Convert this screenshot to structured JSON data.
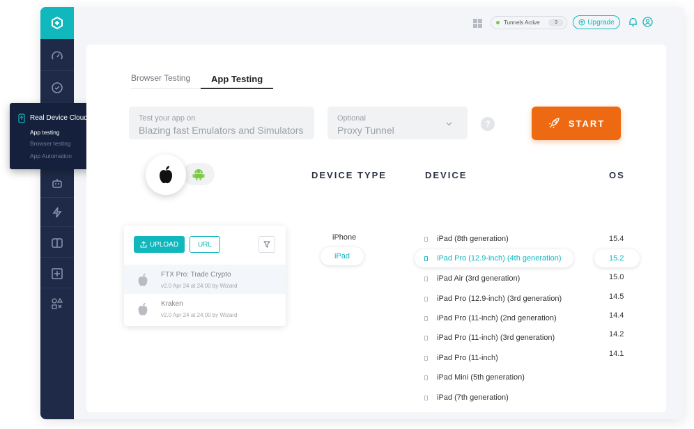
{
  "topbar": {
    "tunnels_label": "Tunnels Active",
    "tunnels_count": "3",
    "upgrade_label": "Upgrade"
  },
  "sidebar": {
    "flyout": {
      "title": "Real Device Cloud",
      "items": [
        {
          "label": "App testing",
          "active": true
        },
        {
          "label": "Browser testing",
          "active": false
        },
        {
          "label": "App Automation",
          "active": false
        }
      ]
    }
  },
  "tabs": {
    "browser": "Browser Testing",
    "app": "App Testing"
  },
  "form": {
    "target_label": "Test your app on",
    "target_value": "Blazing fast Emulators and Simulators",
    "tunnel_label": "Optional",
    "tunnel_value": "Proxy Tunnel",
    "help": "?",
    "start_label": "START"
  },
  "columns": {
    "device_type": "DEVICE TYPE",
    "device": "DEVICE",
    "os": "OS"
  },
  "apps": {
    "upload_label": "UPLOAD",
    "url_label": "URL",
    "items": [
      {
        "name": "FTX Pro: Trade Crypto",
        "meta": "v2.0 Apr 24 at 24:00 by Wizard",
        "selected": true
      },
      {
        "name": "Kraken",
        "meta": "v2.0 Apr 24 at 24:00 by Wizard",
        "selected": false
      }
    ]
  },
  "device_types": [
    {
      "label": "iPhone",
      "selected": false
    },
    {
      "label": "iPad",
      "selected": true
    }
  ],
  "devices": [
    {
      "label": "iPad (8th generation)",
      "selected": false
    },
    {
      "label": "iPad Pro (12.9-inch) (4th generation)",
      "selected": true
    },
    {
      "label": "iPad Air (3rd generation)",
      "selected": false
    },
    {
      "label": "iPad Pro (12.9-inch) (3rd generation)",
      "selected": false
    },
    {
      "label": "iPad Pro (11-inch) (2nd generation)",
      "selected": false
    },
    {
      "label": "iPad Pro (11-inch) (3rd generation)",
      "selected": false
    },
    {
      "label": "iPad Pro (11-inch)",
      "selected": false
    },
    {
      "label": "iPad Mini (5th generation)",
      "selected": false
    },
    {
      "label": "iPad (7th generation)",
      "selected": false
    }
  ],
  "os_versions": [
    {
      "label": "15.4",
      "selected": false
    },
    {
      "label": "15.2",
      "selected": true
    },
    {
      "label": "15.0",
      "selected": false
    },
    {
      "label": "14.5",
      "selected": false
    },
    {
      "label": "14.4",
      "selected": false
    },
    {
      "label": "14.2",
      "selected": false
    },
    {
      "label": "14.1",
      "selected": false
    }
  ],
  "colors": {
    "accent": "#10b7bd",
    "start": "#ee6a12",
    "sidebar": "#1e2a47"
  }
}
